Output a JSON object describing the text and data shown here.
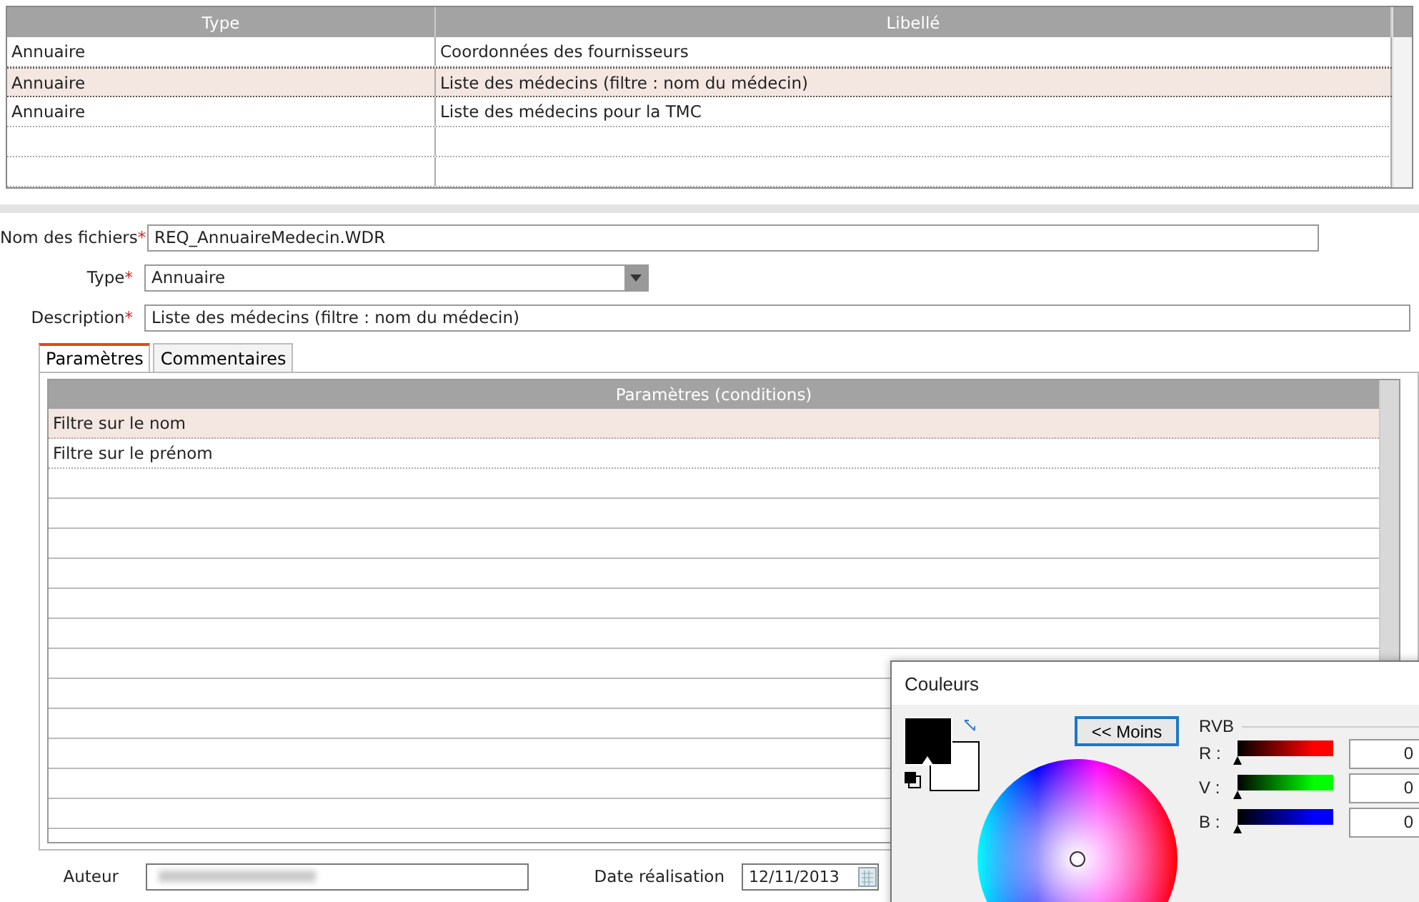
{
  "list": {
    "columns": [
      "Type",
      "Libellé"
    ],
    "rows": [
      {
        "cells": [
          "Annuaire",
          "Coordonnées des fournisseurs"
        ],
        "selected": false
      },
      {
        "cells": [
          "Annuaire",
          "Liste des médecins (filtre : nom du médecin)"
        ],
        "selected": true
      },
      {
        "cells": [
          "Annuaire",
          "Liste des médecins pour la TMC"
        ],
        "selected": false
      }
    ]
  },
  "form": {
    "file_label": "Nom des fichiers",
    "file_value": "REQ_AnnuaireMedecin.WDR",
    "type_label": "Type",
    "type_value": "Annuaire",
    "description_label": "Description",
    "description_value": "Liste des médecins (filtre : nom du médecin)",
    "required_mark": "*"
  },
  "tabs": [
    {
      "label": "Paramètres",
      "selected": true
    },
    {
      "label": "Commentaires",
      "selected": false
    }
  ],
  "params": {
    "column": "Paramètres (conditions)",
    "rows": [
      {
        "text": "Filtre sur le nom",
        "selected": true
      },
      {
        "text": "Filtre sur le prénom",
        "selected": false
      }
    ]
  },
  "footer": {
    "author_label": "Auteur",
    "date_label": "Date réalisation",
    "date_value": "12/11/2013"
  },
  "color_dialog": {
    "title": "Couleurs",
    "less_button": "<< Moins",
    "group": "RVB",
    "channels": [
      {
        "label": "R :",
        "color": "#ff0000",
        "level": 0,
        "value": "0"
      },
      {
        "label": "V :",
        "color": "#00ff00",
        "level": 0,
        "value": "0"
      },
      {
        "label": "B :",
        "color": "#0000ff",
        "level": 0,
        "value": "0"
      }
    ]
  }
}
